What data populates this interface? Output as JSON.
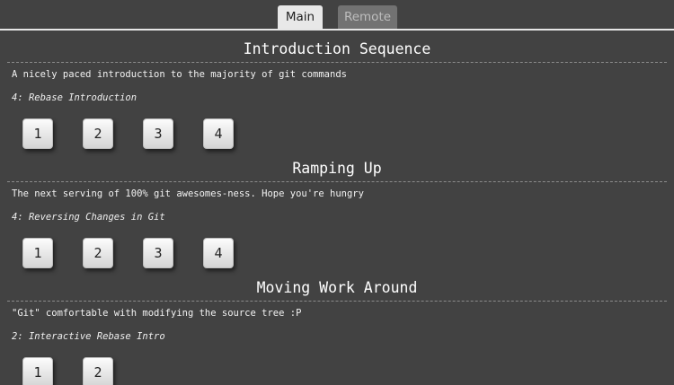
{
  "tabs": [
    {
      "label": "Main",
      "active": true
    },
    {
      "label": "Remote",
      "active": false
    }
  ],
  "sections": [
    {
      "title": "Introduction Sequence",
      "description": "A nicely paced introduction to the majority of git commands",
      "status": "4: Rebase Introduction",
      "levels": [
        "1",
        "2",
        "3",
        "4"
      ]
    },
    {
      "title": "Ramping Up",
      "description": "The next serving of 100% git awesomes-ness. Hope you're hungry",
      "status": "4: Reversing Changes in Git",
      "levels": [
        "1",
        "2",
        "3",
        "4"
      ]
    },
    {
      "title": "Moving Work Around",
      "description": "\"Git\" comfortable with modifying the source tree :P",
      "status": "2: Interactive Rebase Intro",
      "levels": [
        "1",
        "2"
      ]
    }
  ],
  "colors": {
    "background": "#424242",
    "tab_active": "#e8e8e8",
    "tab_inactive": "#727272",
    "button": "#f0f0f0"
  }
}
